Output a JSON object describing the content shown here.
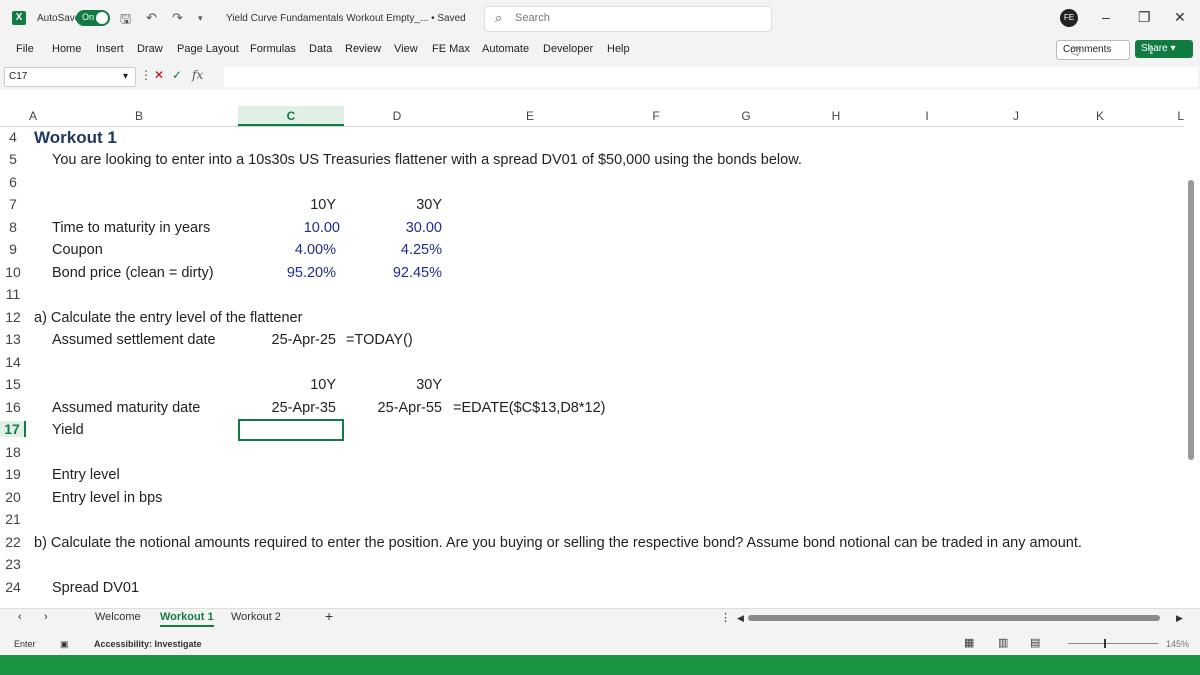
{
  "titlebar": {
    "app_icon": "X",
    "autosave_label": "AutoSave",
    "autosave_state": "On",
    "doc_title": "Yield Curve Fundamentals Workout Empty_... • Saved",
    "search_placeholder": "Search"
  },
  "menu": [
    "File",
    "Home",
    "Insert",
    "Draw",
    "Page Layout",
    "Formulas",
    "Data",
    "Review",
    "View",
    "FE Max",
    "Automate",
    "Developer",
    "Help"
  ],
  "actions": {
    "comments": "Comments",
    "share": "Share"
  },
  "formula_bar": {
    "name_box": "C17",
    "fx": "fx",
    "value": ""
  },
  "columns": [
    "A",
    "B",
    "C",
    "D",
    "E",
    "F",
    "G",
    "H",
    "I",
    "J",
    "K",
    "L"
  ],
  "rows": [
    "4",
    "5",
    "6",
    "7",
    "8",
    "9",
    "10",
    "11",
    "12",
    "13",
    "14",
    "15",
    "16",
    "17",
    "18",
    "19",
    "20",
    "21",
    "22",
    "23",
    "24"
  ],
  "cells": {
    "workout_title": "Workout 1",
    "intro": "You are looking to enter into a 10s30s US Treasuries flattener with a spread DV01 of $50,000 using the bonds below.",
    "hdr_10y": "10Y",
    "hdr_30y": "30Y",
    "ttm_label": "Time to maturity in years",
    "ttm_10y": "10.00",
    "ttm_30y": "30.00",
    "coupon_label": "Coupon",
    "coupon_10y": "4.00%",
    "coupon_30y": "4.25%",
    "price_label": "Bond price (clean = dirty)",
    "price_10y": "95.20%",
    "price_30y": "92.45%",
    "q_a": "a) Calculate the entry level of the flattener",
    "settle_label": "Assumed settlement date",
    "settle_value": "25-Apr-25",
    "settle_formula": "=TODAY()",
    "hdr2_10y": "10Y",
    "hdr2_30y": "30Y",
    "maturity_label": "Assumed maturity date",
    "maturity_10y": "25-Apr-35",
    "maturity_30y": "25-Apr-55",
    "maturity_formula": "=EDATE($C$13,D8*12)",
    "yield_label": "Yield",
    "entry_label": "Entry level",
    "entry_bps_label": "Entry level in bps",
    "q_b": "b) Calculate the notional amounts required to enter the position. Are you buying or selling the respective bond? Assume bond notional can be traded in any amount.",
    "dv01_label": "Spread DV01"
  },
  "sheet_tabs": [
    "Welcome",
    "Workout 1",
    "Workout 2"
  ],
  "active_tab": "Workout 1",
  "status": {
    "mode": "Enter",
    "accessibility": "Accessibility: Investigate",
    "zoom": "145%"
  },
  "colors": {
    "accent": "#107c41",
    "number_blue": "#1f2d8f",
    "title_navy": "#1f3864"
  }
}
